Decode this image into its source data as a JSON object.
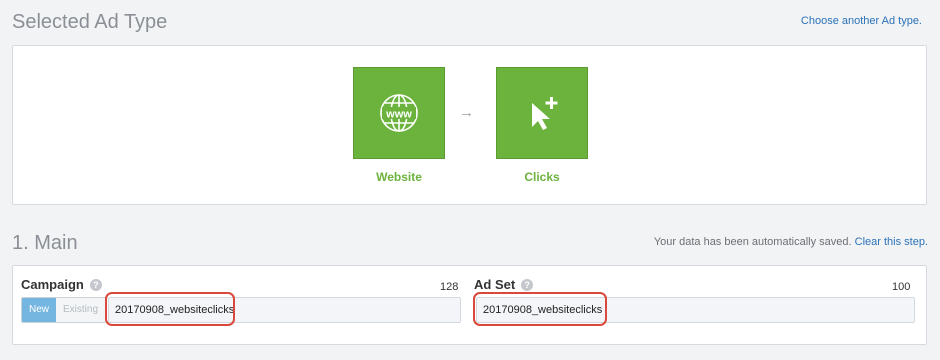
{
  "header": {
    "title": "Selected Ad Type",
    "choose_link": "Choose another Ad type."
  },
  "ad_types": [
    {
      "label": "Website",
      "icon": "globe-www-icon"
    },
    {
      "label": "Clicks",
      "icon": "cursor-plus-icon"
    }
  ],
  "arrow": "→",
  "main": {
    "title": "1. Main",
    "saved_note": "Your data has been automatically saved.",
    "clear_link": "Clear this step."
  },
  "campaign": {
    "label": "Campaign",
    "help": "?",
    "counter": "128",
    "toggle_new": "New",
    "toggle_existing": "Existing",
    "value": "20170908_websiteclicks"
  },
  "adset": {
    "label": "Ad Set",
    "help": "?",
    "counter": "100",
    "value": "20170908_websiteclicks"
  },
  "colors": {
    "accent_green": "#6cb33e",
    "link_blue": "#2b72b8",
    "highlight_red": "#d9483b"
  }
}
